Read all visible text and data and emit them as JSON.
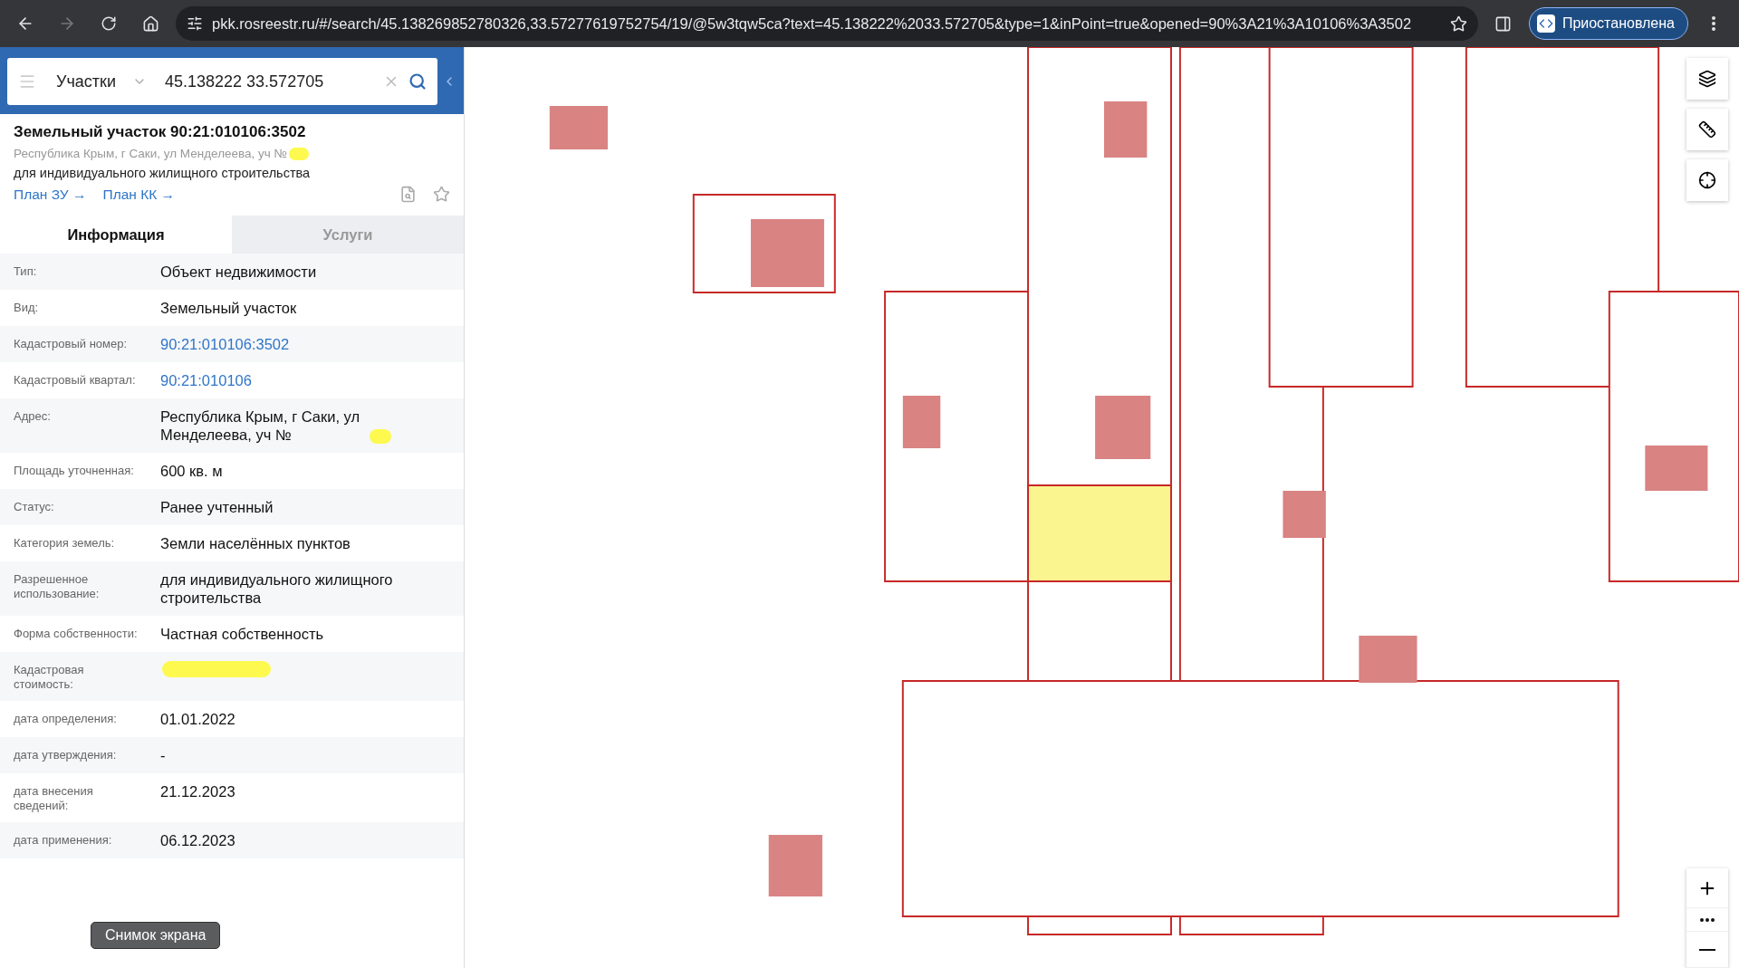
{
  "browser": {
    "url": "pkk.rosreestr.ru/#/search/45.138269852780326,33.57277619752754/19/@5w3tqw5ca?text=45.138222%2033.572705&type=1&inPoint=true&opened=90%3A21%3A10106%3A3502",
    "profile_label": "Приостановлена"
  },
  "search": {
    "category": "Участки",
    "value": "45.138222 33.572705"
  },
  "card": {
    "title": "Земельный участок 90:21:010106:3502",
    "address": "Республика Крым, г Саки, ул Менделеева, уч №",
    "address_redacted": true,
    "usage": "для индивидуального жилищного строительства",
    "links": [
      "План ЗУ →",
      "План КК →"
    ]
  },
  "tabs": [
    {
      "label": "Информация",
      "selected": true
    },
    {
      "label": "Услуги",
      "selected": false
    }
  ],
  "rows": [
    {
      "label": "Тип:",
      "value": "Объект недвижимости",
      "kind": "text"
    },
    {
      "label": "Вид:",
      "value": "Земельный участок",
      "kind": "text"
    },
    {
      "label": "Кадастровый номер:",
      "value": "90:21:010106:3502",
      "kind": "link"
    },
    {
      "label": "Кадастровый квартал:",
      "value": "90:21:010106",
      "kind": "link"
    },
    {
      "label": "Адрес:",
      "value": "Республика Крым, г Саки, ул Менделеева, уч №",
      "kind": "redacted_suffix"
    },
    {
      "label": "Площадь уточненная:",
      "value": "600 кв. м",
      "kind": "text"
    },
    {
      "label": "Статус:",
      "value": "Ранее учтенный",
      "kind": "text"
    },
    {
      "label": "Категория земель:",
      "value": "Земли населённых пунктов",
      "kind": "text"
    },
    {
      "label": "Разрешенное использование:",
      "value": "для индивидуального жилищного строительства",
      "kind": "text"
    },
    {
      "label": "Форма собственности:",
      "value": "Частная собственность",
      "kind": "text"
    },
    {
      "label": "Кадастровая стоимость:",
      "kind": "redacted"
    },
    {
      "label": "дата определения:",
      "value": "01.01.2022",
      "kind": "text"
    },
    {
      "label": "дата утверждения:",
      "value": "-",
      "kind": "text"
    },
    {
      "label": "дата внесения сведений:",
      "value": "21.12.2023",
      "kind": "text"
    },
    {
      "label": "дата применения:",
      "value": "06.12.2023",
      "kind": "text"
    }
  ],
  "tooltip": "Снимок экрана"
}
